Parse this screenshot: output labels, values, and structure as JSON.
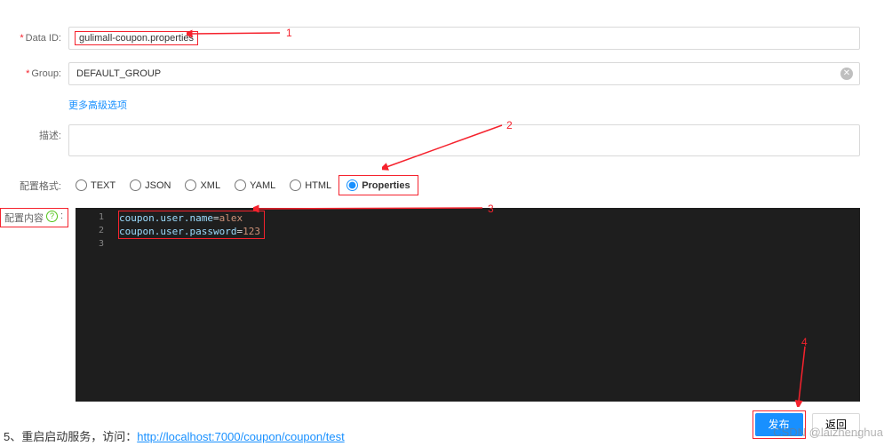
{
  "form": {
    "dataId": {
      "label": "Data ID:",
      "value": "gulimall-coupon.properties"
    },
    "group": {
      "label": "Group:",
      "value": "DEFAULT_GROUP"
    },
    "advanced": "更多高级选项",
    "desc": {
      "label": "描述:",
      "value": ""
    },
    "format": {
      "label": "配置格式:",
      "options": [
        "TEXT",
        "JSON",
        "XML",
        "YAML",
        "HTML",
        "Properties"
      ],
      "selected": "Properties"
    },
    "content": {
      "label": "配置内容",
      "lines": [
        "coupon.user.name=alex",
        "coupon.user.password=123"
      ]
    }
  },
  "buttons": {
    "publish": "发布",
    "back": "返回"
  },
  "annotations": {
    "a1": "1",
    "a2": "2",
    "a3": "3",
    "a4": "4"
  },
  "footer": {
    "prefix": "5、重启启动服务，访问：",
    "url": "http://localhost:7000/coupon/coupon/test"
  },
  "watermark": "CSDN @laizhenghua"
}
